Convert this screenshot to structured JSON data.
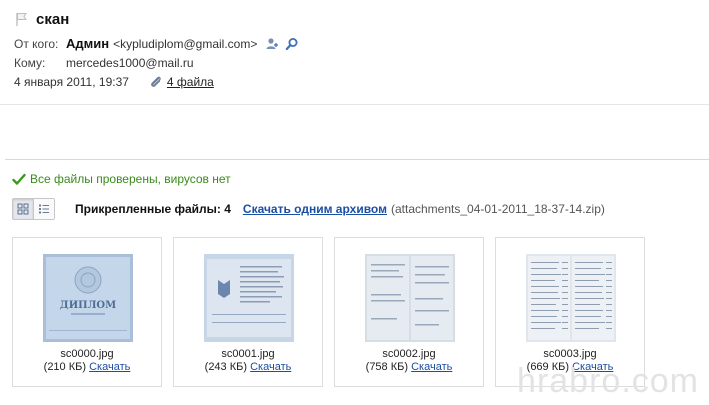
{
  "message": {
    "subject": "скан",
    "from_label": "От кого:",
    "from_name": "Админ",
    "from_email": "<kypludiplom@gmail.com>",
    "to_label": "Кому:",
    "to_email": "mercedes1000@mail.ru",
    "date": "4 января 2011, 19:37",
    "files_link": "4 файла"
  },
  "virus_check": {
    "text": "Все файлы проверены, вирусов нет",
    "color": "#3b8a1b"
  },
  "attachments": {
    "title": "Прикрепленные файлы: 4",
    "archive_link": "Скачать одним архивом",
    "archive_name": "(attachments_04-01-2011_18-37-14.zip)",
    "items": [
      {
        "name": "sc0000.jpg",
        "size": "(210 КБ)",
        "download": "Скачать"
      },
      {
        "name": "sc0001.jpg",
        "size": "(243 КБ)",
        "download": "Скачать"
      },
      {
        "name": "sc0002.jpg",
        "size": "(758 КБ)",
        "download": "Скачать"
      },
      {
        "name": "sc0003.jpg",
        "size": "(669 КБ)",
        "download": "Скачать"
      }
    ]
  },
  "thumb_texts": {
    "diploma_word": "ДИПЛОМ"
  },
  "watermark": "hrabro.com",
  "colors": {
    "link": "#1a4fa3",
    "success": "#3b8a1b"
  }
}
